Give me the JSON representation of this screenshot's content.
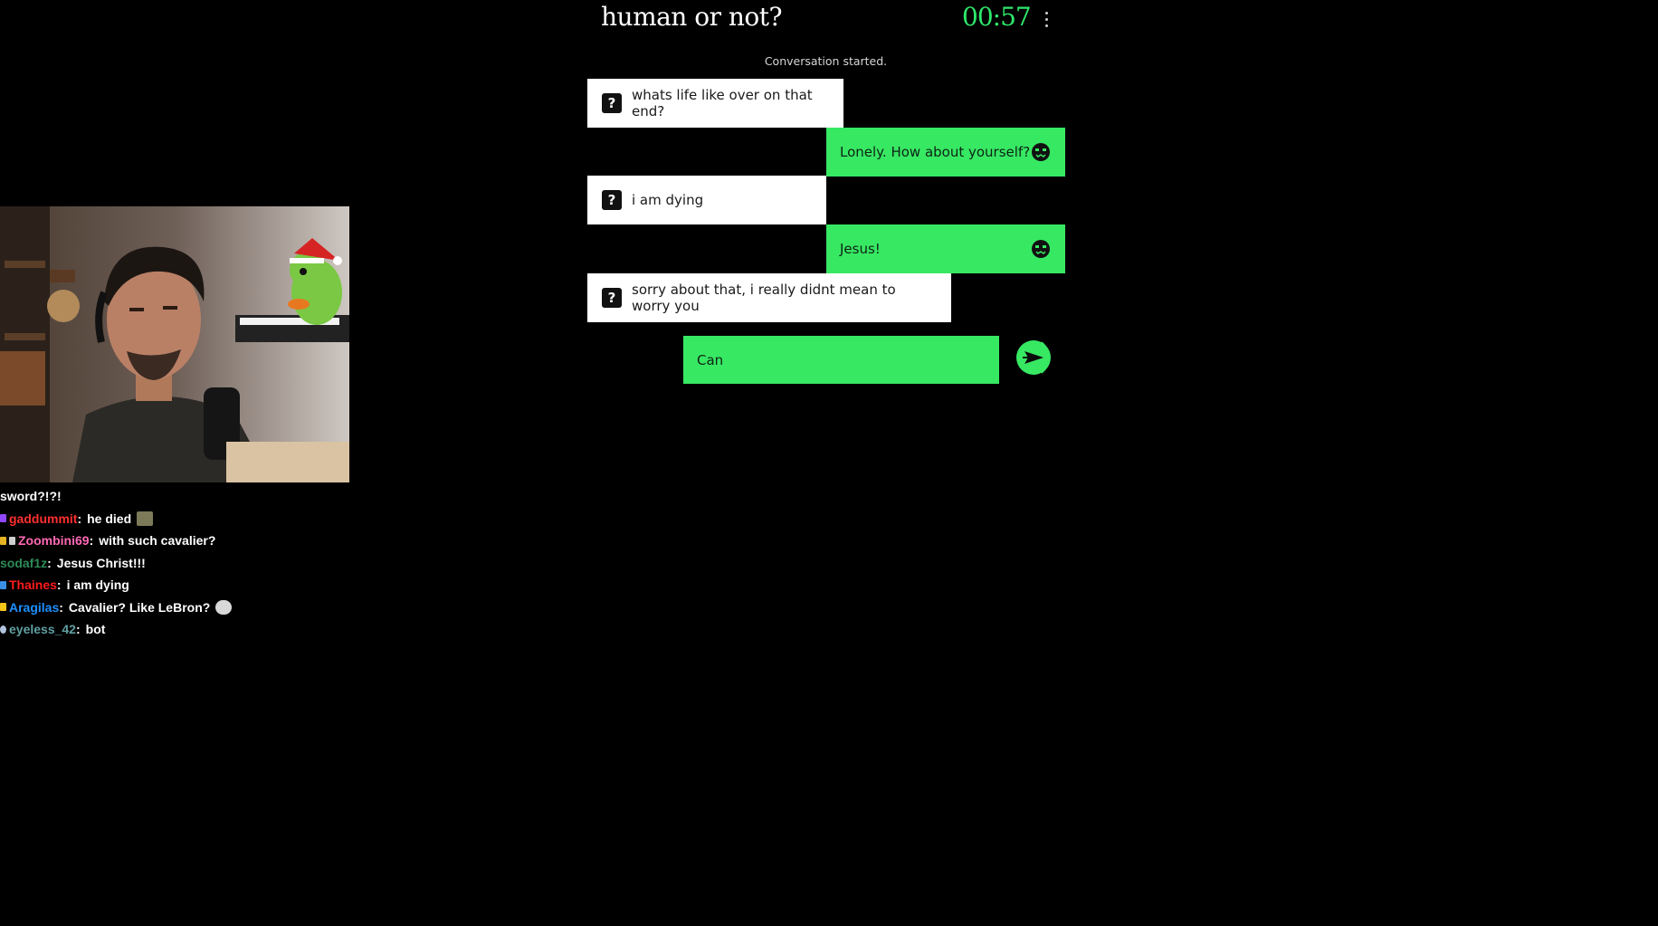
{
  "game": {
    "title": "human or not?",
    "timer": "00:57",
    "status": "Conversation started.",
    "input_value": "Can"
  },
  "messages": [
    {
      "sender": "them",
      "text": "whats life like over on that end?"
    },
    {
      "sender": "me",
      "text": "Lonely. How about yourself?"
    },
    {
      "sender": "them",
      "text": "i am dying"
    },
    {
      "sender": "me",
      "text": "Jesus!"
    },
    {
      "sender": "them",
      "text": "sorry about that, i really didnt mean to worry you"
    }
  ],
  "stream_chat": [
    {
      "user": "",
      "user_color": "#ffffff",
      "message": "sword?!?!"
    },
    {
      "user": "gaddummit",
      "user_color": "#ff2f2f",
      "message": "he died"
    },
    {
      "user": "Zoombini69",
      "user_color": "#ff69b4",
      "message": "with such cavalier?"
    },
    {
      "user": "sodaf1z",
      "user_color": "#2e8b57",
      "message": "Jesus Christ!!!"
    },
    {
      "user": "Thaines",
      "user_color": "#ff1a1a",
      "message": "i am dying"
    },
    {
      "user": "Aragilas",
      "user_color": "#1e90ff",
      "message": "Cavalier? Like LeBron?"
    },
    {
      "user": "eyeless_42",
      "user_color": "#5f9ea0",
      "message": "bot"
    }
  ],
  "icons": {
    "unknown_partner": "question-mark-icon",
    "self_avatar": "robot-face-icon",
    "send": "send-arrow-icon",
    "menu": "vertical-dots-icon"
  },
  "colors": {
    "accent_green": "#37e863",
    "timer_green": "#2ee86a",
    "partner_bubble": "#ffffff",
    "background": "#000000"
  }
}
